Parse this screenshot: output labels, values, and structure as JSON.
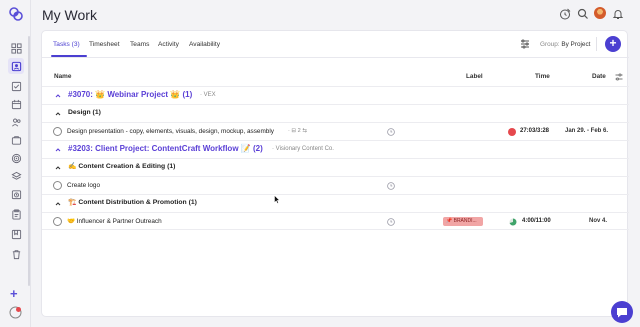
{
  "header": {
    "title": "My Work"
  },
  "tabs": [
    {
      "label": "Tasks (3)",
      "active": true
    },
    {
      "label": "Timesheet"
    },
    {
      "label": "Teams"
    },
    {
      "label": "Activity"
    },
    {
      "label": "Availability"
    }
  ],
  "toolbar": {
    "group_by_label": "Group:",
    "group_by_value": "By Project",
    "add_label": "+"
  },
  "columns": {
    "name": "Name",
    "label": "Label",
    "time": "Time",
    "date": "Date"
  },
  "projects": [
    {
      "title": "#3070: 👑 Webinar Project 👑 (1)",
      "client": "VEX",
      "groups": [
        {
          "title": "Design (1)",
          "tasks": [
            {
              "name": "Design presentation - copy, elements, visuals, design, mockup, assembly",
              "subtasks": "2",
              "time": "27:03/3:28",
              "date": "Jan 29. - Feb 6."
            }
          ]
        }
      ]
    },
    {
      "title": "#3203: Client Project: ContentCraft Workflow 📝 (2)",
      "client": "Visionary Content Co.",
      "groups": [
        {
          "title": "✍️ Content Creation & Editing (1)",
          "tasks": [
            {
              "name": "Create logo"
            }
          ]
        },
        {
          "title": "🏗️ Content Distribution & Promotion (1)",
          "tasks": [
            {
              "name": "🤝 Influencer & Partner Outreach",
              "label": "📌 BRANDI...",
              "time": "4:00/11:00",
              "date": "Nov 4."
            }
          ]
        }
      ]
    }
  ],
  "colors": {
    "accent": "#4b3fd1",
    "project_title": "#5a3fd6",
    "overdue_dot": "#e5484d",
    "progress_dot": "#3fa46a",
    "label_bg": "#f1a5a5"
  },
  "icons": {
    "sidebar": [
      "dashboard-icon",
      "my-work-icon",
      "tasks-icon",
      "calendar-icon",
      "people-icon",
      "projects-icon",
      "goals-icon",
      "layers-icon",
      "timesheet-icon",
      "clipboard-icon",
      "reports-icon",
      "trash-icon"
    ],
    "header": [
      "timer-icon",
      "search-icon",
      "bell-icon"
    ]
  }
}
